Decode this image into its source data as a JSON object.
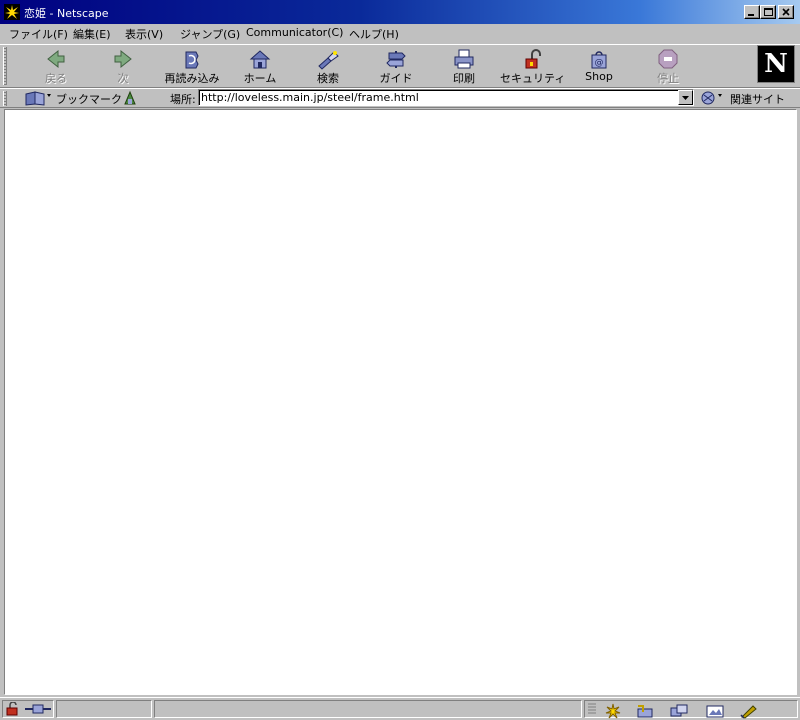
{
  "window": {
    "title": "恋姫 - Netscape"
  },
  "menu": [
    {
      "label": "ファイル(F)"
    },
    {
      "label": "編集(E)"
    },
    {
      "label": "表示(V)"
    },
    {
      "label": "ジャンプ(G)"
    },
    {
      "label": "Communicator(C)"
    },
    {
      "label": "ヘルプ(H)"
    }
  ],
  "toolbar": {
    "back": "戻る",
    "forward": "次",
    "reload": "再読み込み",
    "home": "ホーム",
    "search": "検索",
    "guide": "ガイド",
    "print": "印刷",
    "security": "セキュリティ",
    "shop": "Shop",
    "stop": "停止",
    "logo": "N"
  },
  "location": {
    "bookmarks_label": "ブックマーク",
    "location_label": "場所:",
    "url": "http://loveless.main.jp/steel/frame.html",
    "related_label": "関連サイト"
  },
  "status": {
    "text": ""
  }
}
